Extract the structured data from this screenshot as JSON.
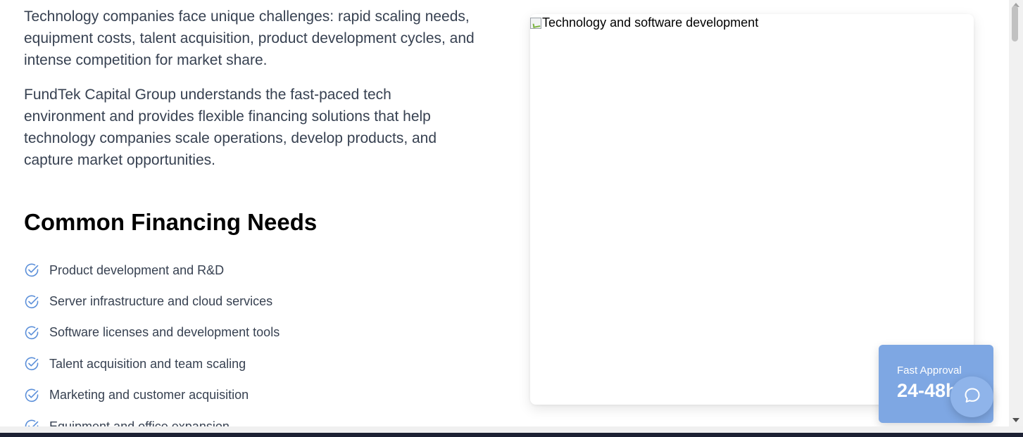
{
  "intro": {
    "paragraph_1": "Technology companies face unique challenges: rapid scaling needs, equipment costs, talent acquisition, product development cycles, and intense competition for market share.",
    "paragraph_2": "FundTek Capital Group understands the fast-paced tech environment and provides flexible financing solutions that help technology companies scale operations, develop products, and capture market opportunities."
  },
  "needs": {
    "heading": "Common Financing Needs",
    "items": [
      {
        "label": "Product development and R&D",
        "icon": "check-circle-icon"
      },
      {
        "label": "Server infrastructure and cloud services",
        "icon": "check-circle-icon"
      },
      {
        "label": "Software licenses and development tools",
        "icon": "check-circle-icon"
      },
      {
        "label": "Talent acquisition and team scaling",
        "icon": "check-circle-icon"
      },
      {
        "label": "Marketing and customer acquisition",
        "icon": "check-circle-icon"
      },
      {
        "label": "Equipment and office expansion",
        "icon": "check-circle-icon"
      }
    ]
  },
  "hero_image": {
    "alt": "Technology and software development",
    "icon": "broken-image-icon"
  },
  "approval_badge": {
    "label": "Fast Approval",
    "value": "24-48h"
  },
  "chat": {
    "icon": "chat-bubble-icon"
  },
  "colors": {
    "accent_blue": "#7ea7e3",
    "check_icon": "#5b8fd9",
    "body_text": "#374151"
  }
}
